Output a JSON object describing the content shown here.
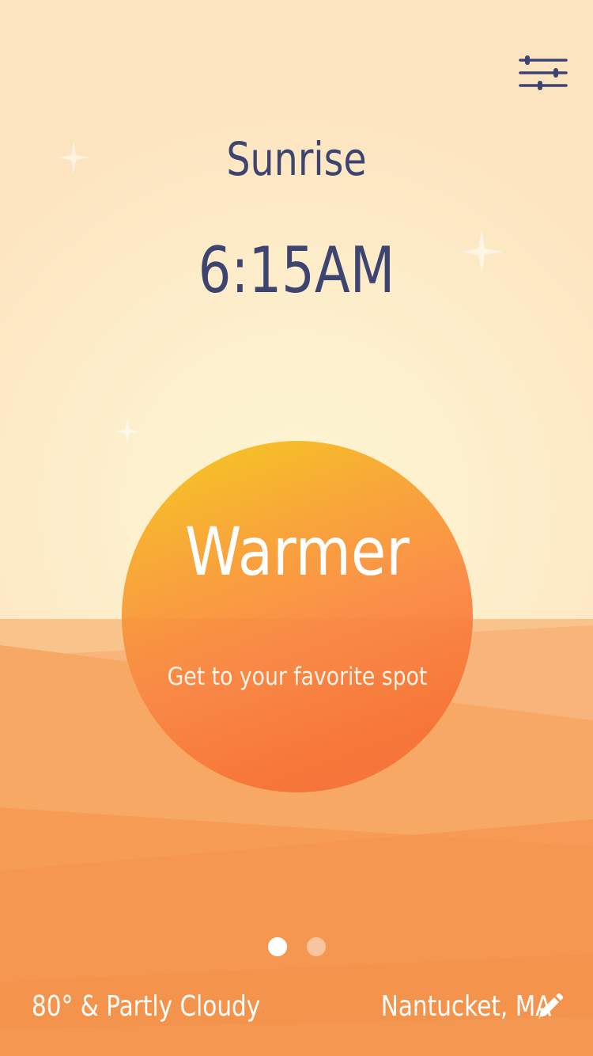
{
  "header": {
    "event_label": "Sunrise",
    "event_time": "6:15AM",
    "settings_icon": "sliders-icon"
  },
  "sun": {
    "title": "Warmer",
    "subtitle": "Get to your favorite spot"
  },
  "pager": {
    "pages": 2,
    "active_index": 0
  },
  "footer": {
    "weather": "80° & Partly Cloudy",
    "location": "Nantucket, MA",
    "edit_icon": "pencil-icon"
  },
  "colors": {
    "text_dark": "#3d4470",
    "sky": "#fdf0cd",
    "sand": "#f7a55e",
    "sun_top": "#f5cb1e",
    "sun_bottom": "#f6703b",
    "white": "#ffffff"
  }
}
